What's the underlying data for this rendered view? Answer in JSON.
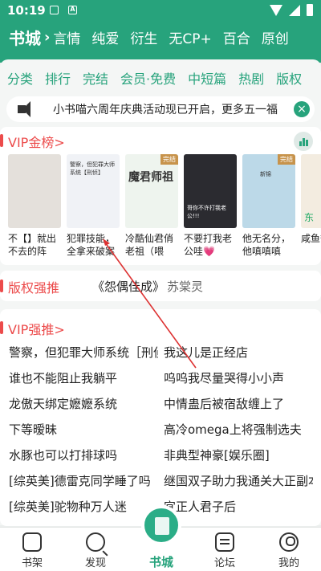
{
  "status": {
    "time": "10:19",
    "icon_a": "A"
  },
  "channels": {
    "active": "书城",
    "items": [
      "言情",
      "纯爱",
      "衍生",
      "无CP+",
      "百合",
      "原创"
    ]
  },
  "categories": [
    "分类",
    "排行",
    "完结",
    "会员·免费",
    "中短篇",
    "热剧",
    "版权"
  ],
  "notice": {
    "text": "小书喵六周年庆典活动现已开启，更多五一福",
    "close": "×"
  },
  "vip_rank": {
    "title": "VIP金榜>",
    "books": [
      {
        "title": "不【】就出不去的阵",
        "color": "#e4e0db",
        "badge": ""
      },
      {
        "title": "犯罪技能，全拿来破案",
        "color": "#f0f2f6",
        "badge": "",
        "cover_text": "警察，但犯罪大师系统【刑侦】"
      },
      {
        "title": "冷酷仙君俏老祖（喂",
        "color": "#eef4ee",
        "badge": "完结",
        "cover_text": "魔君师祖"
      },
      {
        "title": "不要打我老公哇💗",
        "color": "#2b2b30",
        "badge": "",
        "cover_text": "哥你不许打我老公!!!"
      },
      {
        "title": "他无名分，他嗔嗔嗔",
        "color": "#bcd9e8",
        "badge": "完结",
        "cover_text": "新锦"
      },
      {
        "title": "咸鱼*矜",
        "color": "#f3ece0",
        "badge": "",
        "cover_text": "东"
      }
    ]
  },
  "copyright": {
    "label": "版权强推",
    "book": "《怨偶佳成》",
    "author": "苏棠灵"
  },
  "vip_strong": {
    "title": "VIP强推>",
    "left": [
      "警察，但犯罪大师系统［刑侦］",
      "谁也不能阻止我躺平",
      "龙傲天绑定嬷嬷系统",
      "下等暧昧",
      "水豚也可以打排球吗",
      "[综英美]德雷克同学睡了吗",
      "[综英美]驼物种万人迷"
    ],
    "right": [
      "我这儿是正经店",
      "呜呜我尽量哭得小小声",
      "中情蛊后被宿敌缠上了",
      "高冷omega上将强制选夫",
      "非典型神豪[娱乐圈]",
      "继国双子助力我通关大正副本",
      "宜正人君子后"
    ]
  },
  "nav": {
    "items": [
      "书架",
      "发现",
      "书城",
      "论坛",
      "我的"
    ]
  },
  "colors": {
    "brand": "#27a37c",
    "red": "#ec4b4b"
  }
}
